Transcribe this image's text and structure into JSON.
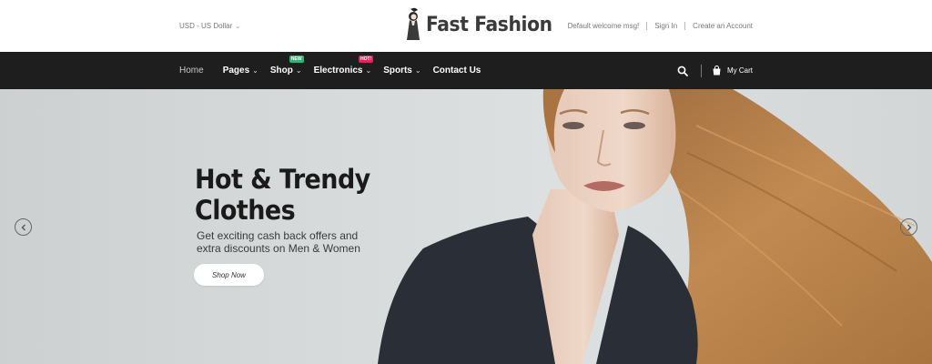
{
  "topbar": {
    "currency_label": "USD - US Dollar",
    "logo_text": "Fast Fashion",
    "welcome_msg": "Default welcome msg!",
    "sign_in": "Sign In",
    "create_account": "Create an Account"
  },
  "nav": {
    "items": [
      {
        "label": "Home",
        "has_dropdown": false
      },
      {
        "label": "Pages",
        "has_dropdown": true
      },
      {
        "label": "Shop",
        "has_dropdown": true,
        "badge": "NEW"
      },
      {
        "label": "Electronics",
        "has_dropdown": true,
        "badge": "HOT!"
      },
      {
        "label": "Sports",
        "has_dropdown": true
      },
      {
        "label": "Contact Us",
        "has_dropdown": false
      }
    ],
    "cart_label": "My Cart"
  },
  "hero": {
    "title_line1": "Hot & Trendy",
    "title_line2": "Clothes",
    "subtitle": "Get exciting cash back offers and extra discounts on Men & Women",
    "cta_label": "Shop Now"
  },
  "icons": [
    "search-icon",
    "cart-icon",
    "chevron-down-icon",
    "chevron-left-icon",
    "chevron-right-icon"
  ],
  "colors": {
    "navbar_bg": "#1e1e1e",
    "badge_new": "#2bb673",
    "badge_hot": "#e0245e",
    "hero_bg": "#d7dadb",
    "hair": "#b07a45",
    "jacket": "#2a2e36"
  }
}
